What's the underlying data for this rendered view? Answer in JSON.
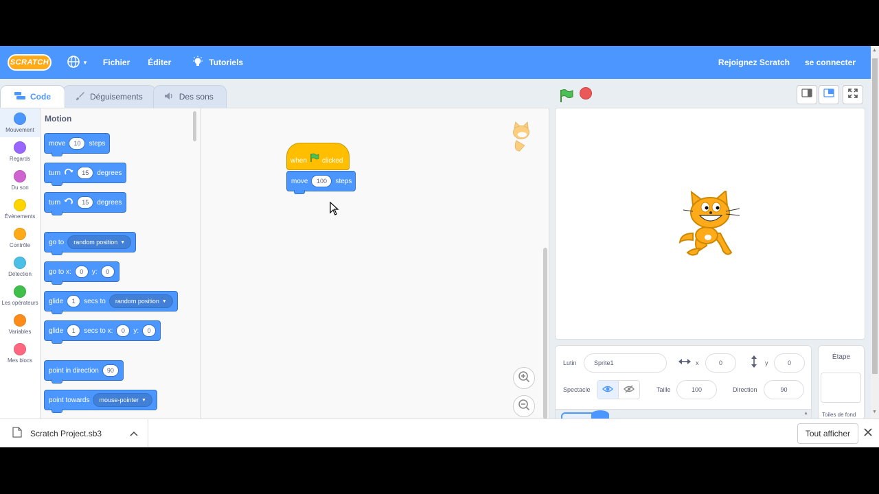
{
  "menubar": {
    "logo": "SCRATCH",
    "file": "Fichier",
    "edit": "Éditer",
    "tutorials": "Tutoriels",
    "join": "Rejoignez Scratch",
    "signin": "se connecter"
  },
  "tabs": {
    "code": "Code",
    "costumes": "Déguisements",
    "sounds": "Des sons"
  },
  "categories": [
    {
      "label": "Mouvement",
      "color": "#4c97ff"
    },
    {
      "label": "Regards",
      "color": "#9966ff"
    },
    {
      "label": "Du son",
      "color": "#cf63cf"
    },
    {
      "label": "Événements",
      "color": "#ffd500"
    },
    {
      "label": "Contrôle",
      "color": "#ffab19"
    },
    {
      "label": "Détection",
      "color": "#4cbfe6"
    },
    {
      "label": "Les opérateurs",
      "color": "#40bf4a"
    },
    {
      "label": "Variables",
      "color": "#ff8c1a"
    },
    {
      "label": "Mes blocs",
      "color": "#ff6680"
    }
  ],
  "palette": {
    "title": "Motion",
    "move": {
      "pre": "move",
      "val": "10",
      "post": "steps"
    },
    "turn_right": {
      "pre": "turn",
      "val": "15",
      "post": "degrees"
    },
    "turn_left": {
      "pre": "turn",
      "val": "15",
      "post": "degrees"
    },
    "goto": {
      "pre": "go to",
      "dd": "random position"
    },
    "goto_xy": {
      "pre": "go to x:",
      "x": "0",
      "ylbl": "y:",
      "y": "0"
    },
    "glide": {
      "pre": "glide",
      "val": "1",
      "mid": "secs to",
      "dd": "random position"
    },
    "glide_xy": {
      "pre": "glide",
      "val": "1",
      "mid": "secs to x:",
      "x": "0",
      "ylbl": "y:",
      "y": "0"
    },
    "point_dir": {
      "pre": "point in direction",
      "val": "90"
    },
    "point_towards": {
      "pre": "point towards",
      "dd": "mouse-pointer"
    }
  },
  "script": {
    "hat": {
      "pre": "when",
      "post": "clicked"
    },
    "move": {
      "pre": "move",
      "val": "100",
      "post": "steps"
    }
  },
  "sprite_info": {
    "sprite_label": "Lutin",
    "sprite_name": "Sprite1",
    "x_label": "x",
    "x": "0",
    "y_label": "y",
    "y": "0",
    "show_label": "Spectacle",
    "size_label": "Taille",
    "size": "100",
    "direction_label": "Direction",
    "direction": "90"
  },
  "stage_panel": {
    "title": "Étape",
    "backdrops": "Toiles de fond"
  },
  "download": {
    "file": "Scratch Project.sb3",
    "show_all": "Tout afficher"
  }
}
